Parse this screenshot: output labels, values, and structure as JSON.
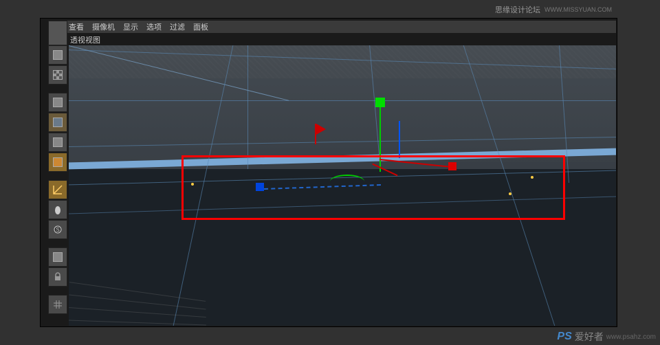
{
  "header": {
    "menu": [
      "查看",
      "摄像机",
      "显示",
      "选项",
      "过滤",
      "面板"
    ]
  },
  "panelLabel": "透视视图",
  "watermark": {
    "top_text": "思缘设计论坛",
    "top_url": "WWW.MISSYUAN.COM",
    "bottom_brand": "PS",
    "bottom_cn": "爱好者",
    "bottom_url": "www.psahz.com"
  },
  "tools": [
    {
      "name": "live-selection",
      "icon": "cube"
    },
    {
      "name": "uv-checker",
      "icon": "checker"
    },
    {
      "name": "spacer"
    },
    {
      "name": "model-mode",
      "icon": "cube"
    },
    {
      "name": "edge-mode",
      "icon": "cube",
      "active": true
    },
    {
      "name": "poly-mode",
      "icon": "cube"
    },
    {
      "name": "point-mode",
      "icon": "cube",
      "orange": true
    },
    {
      "name": "spacer"
    },
    {
      "name": "axis-tool",
      "icon": "axis",
      "orange": true
    },
    {
      "name": "mouse-tool",
      "icon": "mouse"
    },
    {
      "name": "snap-tool",
      "icon": "snap"
    },
    {
      "name": "spacer"
    },
    {
      "name": "move-tool",
      "icon": "cube"
    },
    {
      "name": "lock-tool",
      "icon": "lock"
    },
    {
      "name": "spacer"
    },
    {
      "name": "grid-tool",
      "icon": "grid"
    }
  ]
}
